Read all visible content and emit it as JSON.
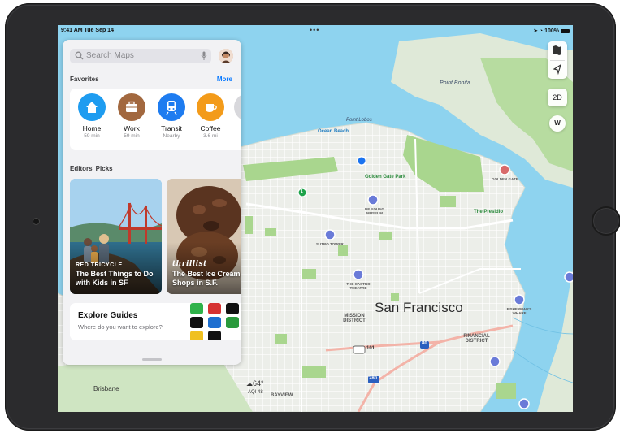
{
  "status": {
    "time": "9:41 AM  Tue Sep 14",
    "dots": "•••",
    "battery": "100%"
  },
  "search": {
    "placeholder": "Search Maps"
  },
  "favorites": {
    "title": "Favorites",
    "more": "More",
    "items": [
      {
        "name": "Home",
        "sub": "59 min",
        "color": "#1e9cf0",
        "icon": "house-icon"
      },
      {
        "name": "Work",
        "sub": "59 min",
        "color": "#a2683f",
        "icon": "briefcase-icon"
      },
      {
        "name": "Transit",
        "sub": "Nearby",
        "color": "#1e7cf0",
        "icon": "train-icon"
      },
      {
        "name": "Coffee",
        "sub": "3.6 mi",
        "color": "#f39b1a",
        "icon": "cup-icon"
      }
    ]
  },
  "editors": {
    "title": "Editors' Picks",
    "cards": [
      {
        "brand": "RED TRICYCLE",
        "text": "The Best Things to Do with Kids in SF"
      },
      {
        "brand": "thrillist",
        "text": "The Best Ice Cream Shops in S.F."
      }
    ]
  },
  "guides": {
    "title": "Explore Guides",
    "subtitle": "Where do you want to explore?"
  },
  "map_controls": {
    "mode": "2D",
    "compass": "W"
  },
  "weather": {
    "temp": "64°",
    "aqi": "AQI 48"
  },
  "map_labels": {
    "city": "San Francisco",
    "point_bonita": "Point Bonita",
    "point_lobos": "Point Lobos",
    "ocean_beach": "Ocean Beach",
    "golden_gate_park": "Golden Gate Park",
    "mission_district": "MISSION DISTRICT",
    "financial_district": "FINANCIAL DISTRICT",
    "the_presidio": "The Presidio",
    "sutro_tower": "SUTRO TOWER",
    "castro_theatre": "THE CASTRO THEATRE",
    "de_young": "DE YOUNG MUSEUM",
    "fisherman_wharf": "FISHERMAN'S WHARF",
    "golden_gate": "GOLDEN GATE",
    "brisbane": "Brisbane",
    "hwy_101": "101",
    "hwy_80": "80",
    "hwy_280": "280",
    "hwy_1": "1",
    "bayview": "BAYVIEW"
  }
}
